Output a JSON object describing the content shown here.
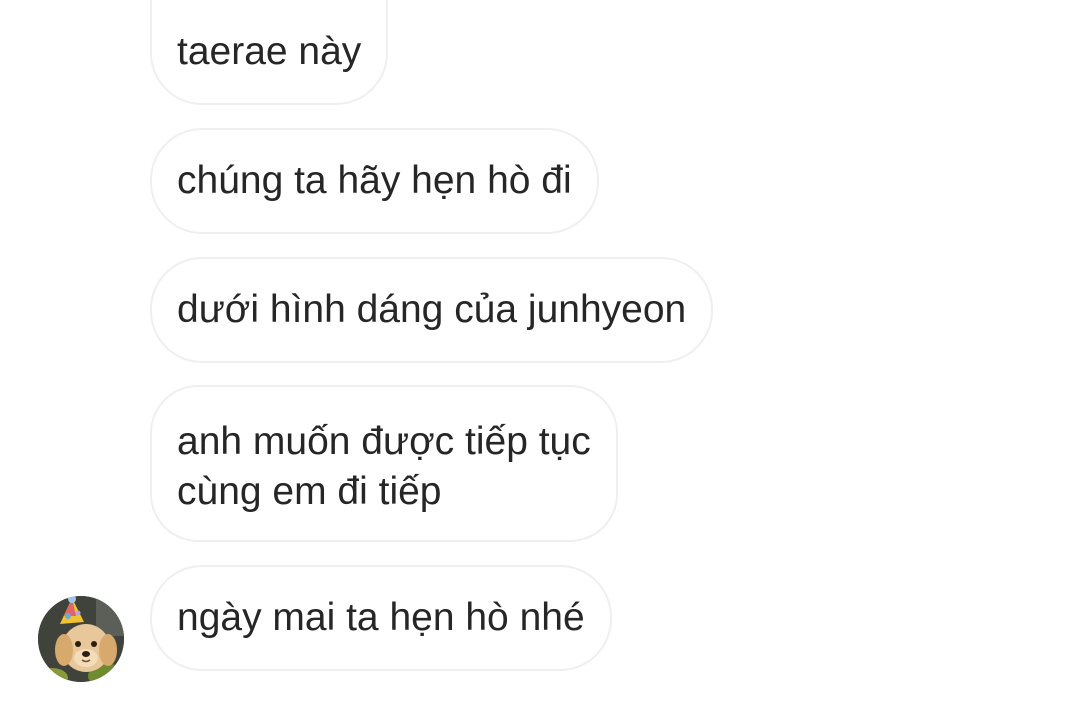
{
  "messages": [
    {
      "text": "taerae này"
    },
    {
      "text": "chúng ta hãy hẹn hò đi"
    },
    {
      "text": "dưới hình dáng của junhyeon"
    },
    {
      "text": "anh muốn được tiếp tục\ncùng em đi tiếp"
    },
    {
      "text": "ngày mai ta hẹn hò nhé"
    }
  ],
  "avatar": {
    "icon": "golden-retriever-puppy-with-party-hat-avatar"
  },
  "colors": {
    "bubble_border": "#efefef",
    "text": "#262626",
    "background": "#ffffff"
  }
}
